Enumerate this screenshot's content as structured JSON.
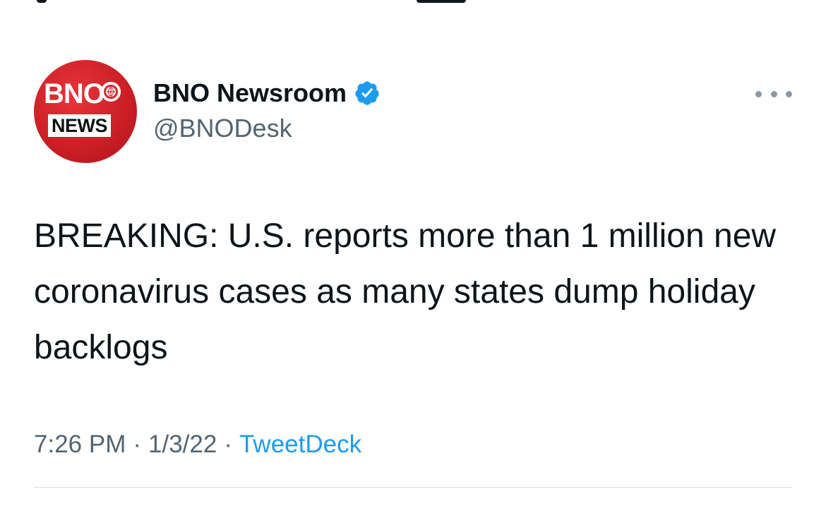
{
  "author": {
    "display_name": "BNO Newsroom",
    "handle": "@BNODesk",
    "verified": true,
    "avatar_logo_top": "BNO",
    "avatar_logo_bottom": "NEWS"
  },
  "tweet": {
    "text": "BREAKING: U.S. reports more than 1 million new coronavirus cases as many states dump holiday backlogs",
    "time": "7:26 PM",
    "date": "1/3/22",
    "separator": "·",
    "source": "TweetDeck"
  },
  "icons": {
    "more": "more-options-icon",
    "verified": "verified-badge-icon",
    "globe": "globe-icon"
  },
  "colors": {
    "text_primary": "#0f1419",
    "text_secondary": "#536471",
    "link": "#1d9bf0",
    "verified": "#1d9bf0",
    "avatar_red": "#cc1f26"
  }
}
